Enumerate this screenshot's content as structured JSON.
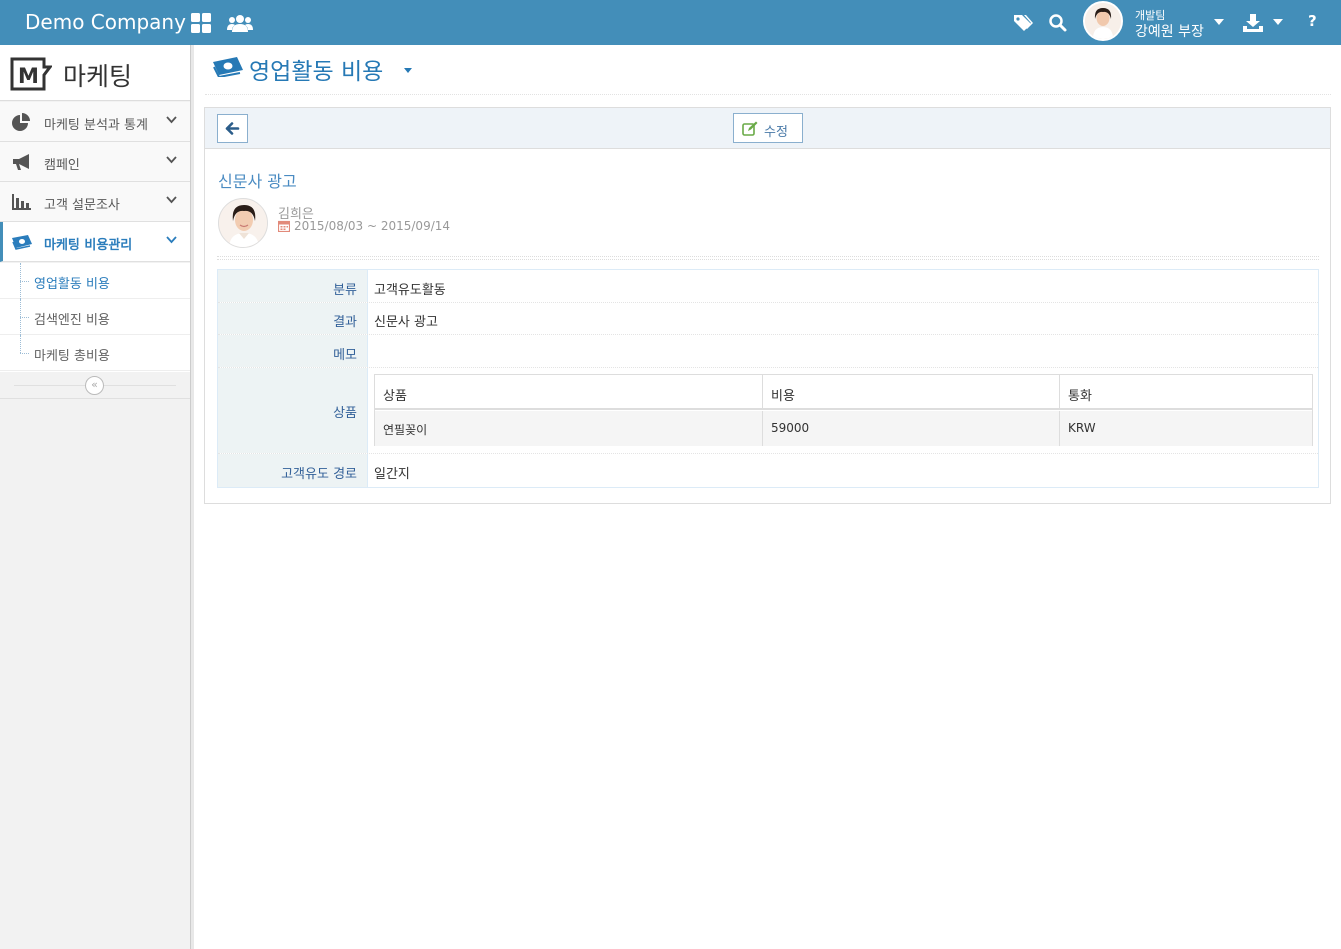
{
  "topbar": {
    "brand": "Demo Company",
    "user_team": "개발팀",
    "user_name": "강예원 부장",
    "help": "?"
  },
  "sidebar": {
    "title": "마케팅",
    "menu": [
      {
        "label": "마케팅 분석과 통계",
        "icon": "pie-chart-icon"
      },
      {
        "label": "캠페인",
        "icon": "bullhorn-icon"
      },
      {
        "label": "고객 설문조사",
        "icon": "bar-chart-icon"
      },
      {
        "label": "마케팅 비용관리",
        "icon": "money-icon",
        "active": true
      }
    ],
    "submenu": [
      {
        "label": "영업활동 비용",
        "active": true
      },
      {
        "label": "검색엔진 비용"
      },
      {
        "label": "마케팅 총비용"
      }
    ],
    "collapse": "«"
  },
  "page": {
    "title": "영업활동 비용"
  },
  "toolbar": {
    "edit_label": "수정"
  },
  "record": {
    "title": "신문사 광고",
    "author": "김희은",
    "period": "2015/08/03 ~ 2015/09/14",
    "fields": {
      "category_label": "분류",
      "category_value": "고객유도활동",
      "result_label": "결과",
      "result_value": "신문사 광고",
      "memo_label": "메모",
      "memo_value": "",
      "products_label": "상품",
      "channel_label": "고객유도 경로",
      "channel_value": "일간지"
    },
    "products": {
      "headers": [
        "상품",
        "비용",
        "통화"
      ],
      "rows": [
        [
          "연필꽂이",
          "59000",
          "KRW"
        ]
      ]
    }
  },
  "colors": {
    "primary": "#438eb9",
    "link": "#2679b5",
    "label": "#336199"
  }
}
